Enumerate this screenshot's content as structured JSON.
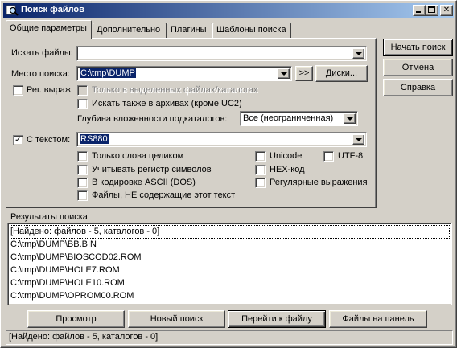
{
  "window": {
    "title": "Поиск файлов"
  },
  "tabs": [
    {
      "label": "Общие параметры"
    },
    {
      "label": "Дополнительно"
    },
    {
      "label": "Плагины"
    },
    {
      "label": "Шаблоны поиска"
    }
  ],
  "search_files": {
    "label": "Искать файлы:",
    "value": ""
  },
  "search_location": {
    "label": "Место поиска:",
    "value": "C:\\tmp\\DUMP",
    "more_label": ">>",
    "drives_label": "Диски..."
  },
  "regex_option": {
    "label": "Рег. выраж",
    "checked": false
  },
  "only_selected": {
    "label": "Только в выделенных файлах/каталогах",
    "checked": false
  },
  "search_archives": {
    "label": "Искать также в архивах (кроме UC2)",
    "checked": false
  },
  "subdir_depth": {
    "label": "Глубина вложенности подкаталогов:",
    "value": "Все (неограниченная)"
  },
  "with_text": {
    "label": "С текстом:",
    "checked": true,
    "value": "RS880"
  },
  "text_options": {
    "whole_words": {
      "label": "Только слова целиком",
      "checked": false
    },
    "case": {
      "label": "Учитывать регистр символов",
      "checked": false
    },
    "ascii": {
      "label": "В кодировке ASCII (DOS)",
      "checked": false
    },
    "not_containing": {
      "label": "Файлы, НЕ содержащие этот текст",
      "checked": false
    },
    "unicode": {
      "label": "Unicode",
      "checked": false
    },
    "utf8": {
      "label": "UTF-8",
      "checked": false
    },
    "hex": {
      "label": "HEX-код",
      "checked": false
    },
    "regex": {
      "label": "Регулярные выражения",
      "checked": false
    }
  },
  "side_buttons": {
    "start": "Начать поиск",
    "cancel": "Отмена",
    "help": "Справка"
  },
  "results": {
    "group_label": "Результаты поиска",
    "items": [
      "[Найдено: файлов - 5, каталогов - 0]",
      "C:\\tmp\\DUMP\\BB.BIN",
      "C:\\tmp\\DUMP\\BIOSCOD02.ROM",
      "C:\\tmp\\DUMP\\HOLE7.ROM",
      "C:\\tmp\\DUMP\\HOLE10.ROM",
      "C:\\tmp\\DUMP\\OPROM00.ROM"
    ]
  },
  "bottom_buttons": {
    "view": "Просмотр",
    "new_search": "Новый поиск",
    "goto_file": "Перейти к файлу",
    "to_panel": "Файлы на панель"
  },
  "status": "[Найдено: файлов - 5, каталогов - 0]",
  "colors": {
    "titlebar_start": "#0a246a",
    "titlebar_end": "#a6caf0",
    "face": "#d4d0c8",
    "selection": "#0a246a"
  },
  "icons": {
    "app": "magnifier-icon",
    "minimize": "minimize-icon",
    "maximize": "maximize-icon",
    "close": "close-icon",
    "check": "checkmark-icon",
    "dropdown": "chevron-down-icon"
  }
}
